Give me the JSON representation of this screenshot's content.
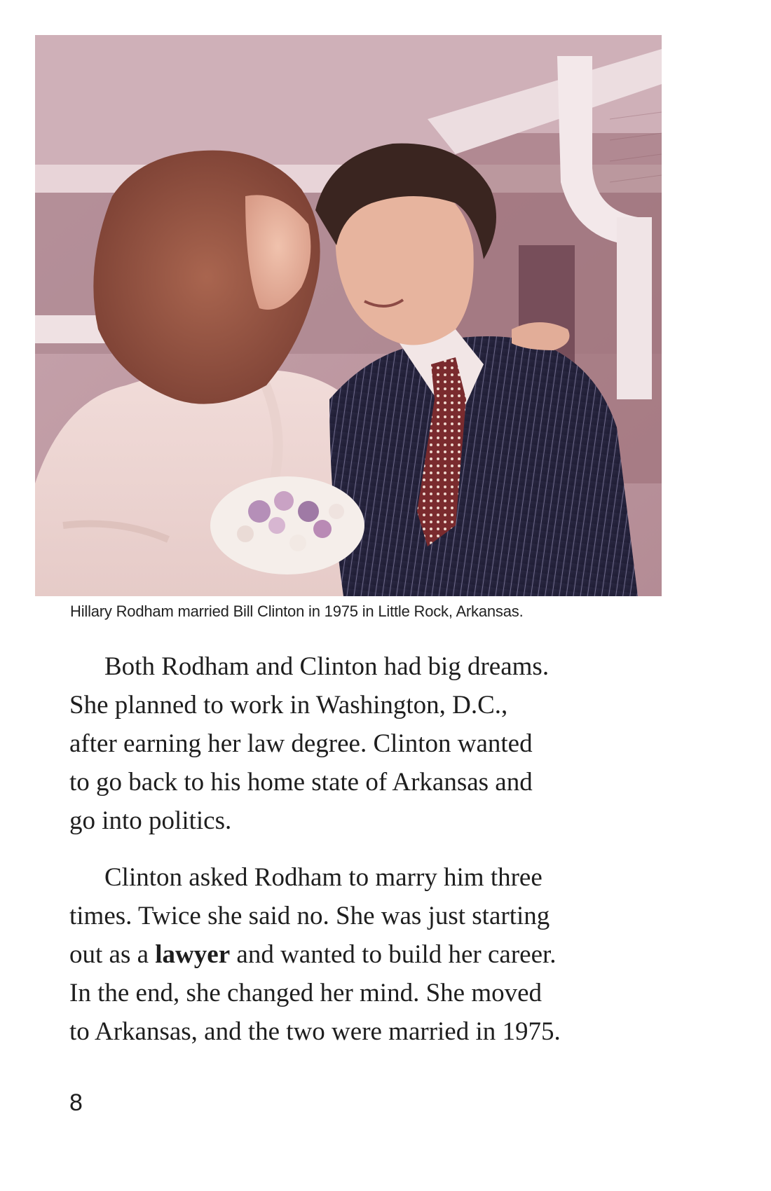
{
  "photo": {
    "alt": "Hillary Rodham and Bill Clinton on their wedding day"
  },
  "caption": "Hillary Rodham married Bill Clinton in 1975 in Little Rock, Arkansas.",
  "paragraphs": [
    {
      "lines": [
        "Both Rodham and Clinton had big dreams.",
        "She planned to work in Washington, D.C.,",
        "after earning her law degree. Clinton wanted",
        "to go back to his home state of Arkansas and",
        "go into politics."
      ]
    },
    {
      "lines": [
        "Clinton asked Rodham to marry him three",
        "times. Twice she said no. She was just starting"
      ],
      "line3_before": "out as a ",
      "line3_bold": "lawyer",
      "line3_after": " and wanted to build her career.",
      "lines_end": [
        "In the end, she changed her mind. She moved",
        "to Arkansas, and the two were married in 1975."
      ]
    }
  ],
  "page_number": "8"
}
